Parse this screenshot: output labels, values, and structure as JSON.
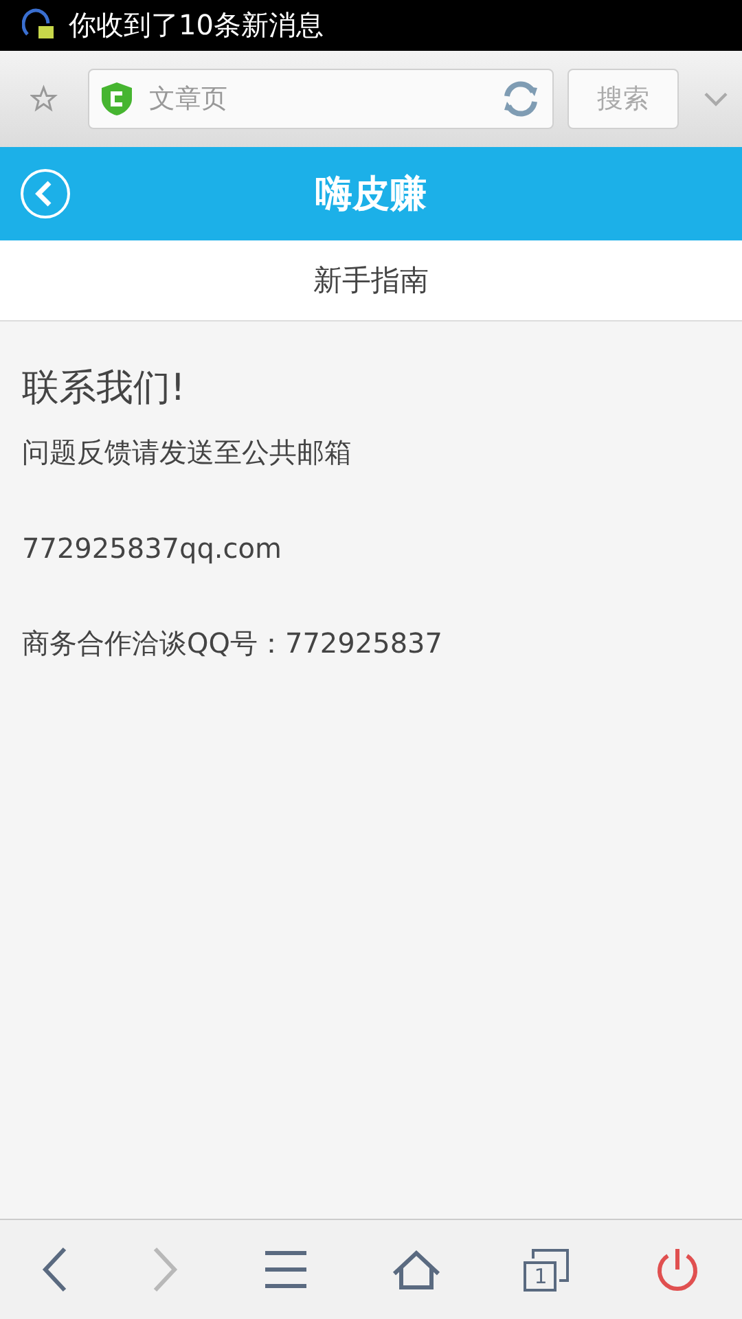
{
  "status_bar": {
    "notification": "你收到了10条新消息"
  },
  "browser_bar": {
    "address": {
      "placeholder": "文章页"
    },
    "search_button": "搜索"
  },
  "header": {
    "title": "嗨皮赚"
  },
  "subtitle": "新手指南",
  "content": {
    "heading": "联系我们!",
    "paragraphs": [
      "问题反馈请发送至公共邮箱",
      "772925837qq.com",
      "商务合作洽谈QQ号：772925837"
    ]
  },
  "toolbar": [
    {
      "kind": "back",
      "disabled": false
    },
    {
      "kind": "forward",
      "disabled": true
    },
    {
      "kind": "menu",
      "disabled": false
    },
    {
      "kind": "home",
      "disabled": false
    },
    {
      "kind": "tabs",
      "count": "1",
      "disabled": false
    },
    {
      "kind": "power",
      "disabled": false
    }
  ]
}
